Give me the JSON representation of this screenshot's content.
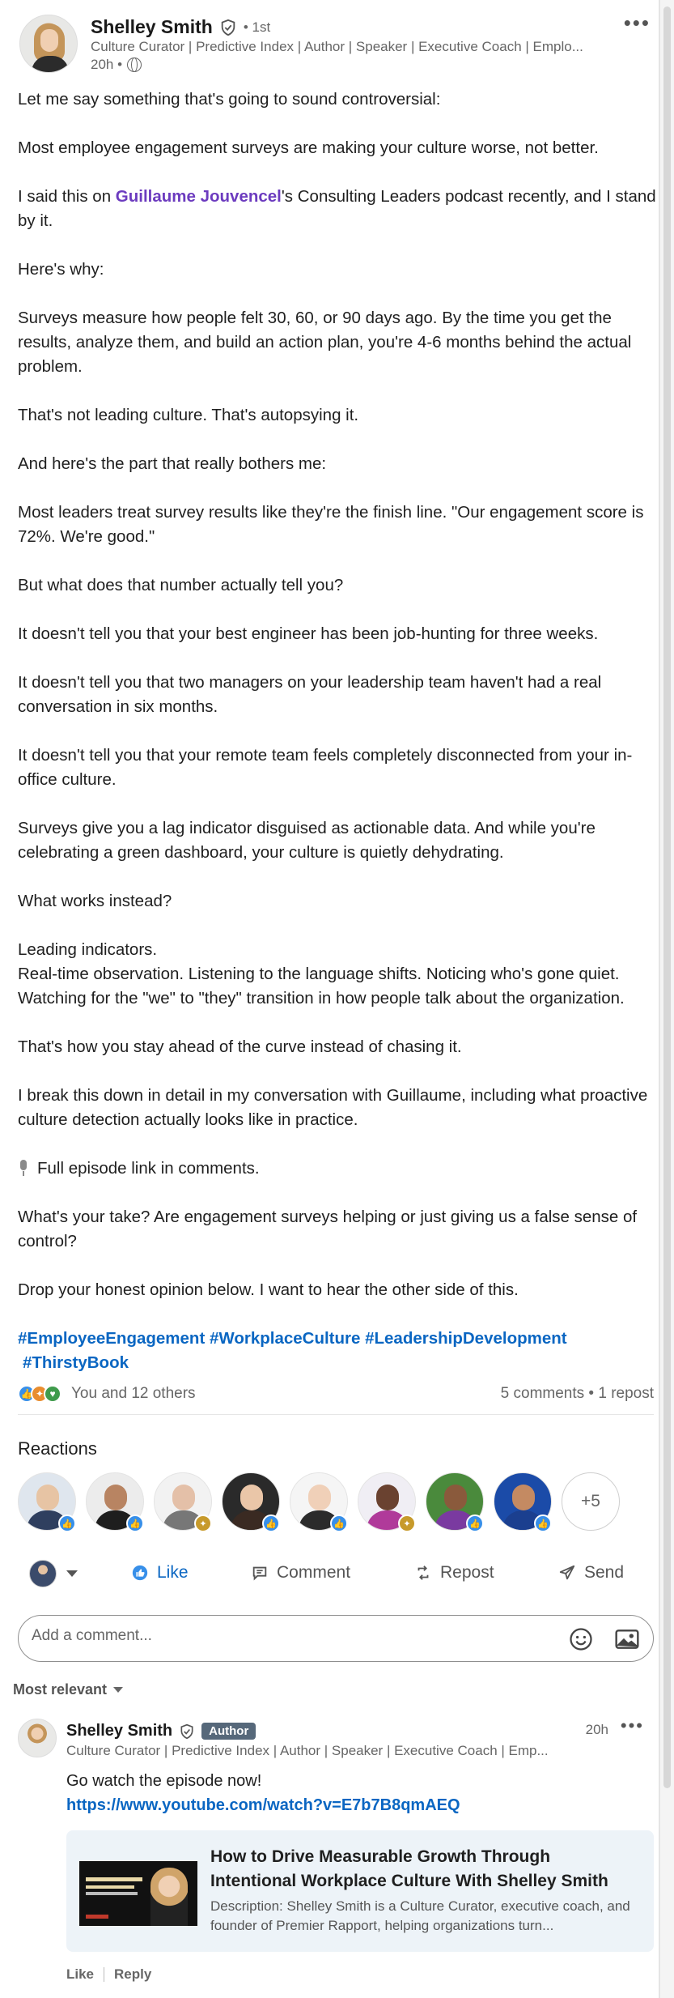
{
  "post": {
    "author": {
      "name": "Shelley Smith",
      "degree": "• 1st",
      "headline": "Culture Curator | Predictive Index | Author | Speaker | Executive Coach | Emplo...",
      "time": "20h •"
    },
    "body": {
      "p1": "Let me say something that's going to sound controversial:",
      "p2": "Most employee engagement surveys are making your culture worse, not better.",
      "p3_before": "I said this on ",
      "p3_mention": "Guillaume Jouvencel",
      "p3_after": "'s Consulting Leaders podcast recently, and I stand by it.",
      "p4": "Here's why:",
      "p5": "Surveys measure how people felt 30, 60, or 90 days ago. By the time you get the results, analyze them, and build an action plan, you're 4-6 months behind the actual problem.",
      "p6": "That's not leading culture. That's autopsying it.",
      "p7": "And here's the part that really bothers me:",
      "p8": "Most leaders treat survey results like they're the finish line. \"Our engagement score is 72%. We're good.\"",
      "p9": "But what does that number actually tell you?",
      "p10": "It doesn't tell you that your best engineer has been job-hunting for three weeks.",
      "p11": "It doesn't tell you that two managers on your leadership team haven't had a real conversation in six months.",
      "p12": "It doesn't tell you that your remote team feels completely disconnected from your in-office culture.",
      "p13": "Surveys give you a lag indicator disguised as actionable data. And while you're celebrating a green dashboard, your culture is quietly dehydrating.",
      "p14": "What works instead?",
      "p15_l1": "Leading indicators.",
      "p15_l2": "Real-time observation. Listening to the language shifts. Noticing who's gone quiet. Watching for the \"we\" to \"they\" transition in how people talk about the organization.",
      "p16": "That's how you stay ahead of the curve instead of chasing it.",
      "p17": "I break this down in detail in my conversation with Guillaume, including what proactive culture detection actually looks like in practice.",
      "p18": "Full episode link in comments.",
      "p19": "What's your take? Are engagement surveys helping or just giving us a false sense of control?",
      "p20": "Drop your honest opinion below. I want to hear the other side of this.",
      "hashtags_l1": "#EmployeeEngagement #WorkplaceCulture #LeadershipDevelopment",
      "hashtags_l2": "#ThirstyBook"
    },
    "social": {
      "reactions_text": "You and 12 others",
      "comments_reposts": "5 comments • 1 repost"
    }
  },
  "reactions_section": {
    "title": "Reactions",
    "more_label": "+5",
    "reactors": [
      {
        "badge": "like",
        "face": "#e7c4a4",
        "body": "#2f3f5f",
        "bg": "#dfe6ee"
      },
      {
        "badge": "like",
        "face": "#b88462",
        "body": "#1e1e1e",
        "bg": "#ececec"
      },
      {
        "badge": "insightful",
        "face": "#e4c0a8",
        "body": "#777777",
        "bg": "#f2f2f2"
      },
      {
        "badge": "like",
        "face": "#eac6a8",
        "body": "#3a2a22",
        "bg": "#2a2a2a"
      },
      {
        "badge": "like",
        "face": "#f0d0b8",
        "body": "#2b2b2b",
        "bg": "#f5f5f5"
      },
      {
        "badge": "insightful",
        "face": "#6a4230",
        "body": "#b03a9a",
        "bg": "#f0eef4"
      },
      {
        "badge": "like",
        "face": "#8a5a3c",
        "body": "#7a3aa0",
        "bg": "#4a8a3c"
      },
      {
        "badge": "like",
        "face": "#c48a62",
        "body": "#1b3f8f",
        "bg": "#1b4ba8"
      }
    ]
  },
  "actions": {
    "like": "Like",
    "comment": "Comment",
    "repost": "Repost",
    "send": "Send"
  },
  "comment_box": {
    "placeholder": "Add a comment..."
  },
  "sort": {
    "label": "Most relevant"
  },
  "comment": {
    "name": "Shelley Smith",
    "author_badge": "Author",
    "time": "20h",
    "headline": "Culture Curator | Predictive Index | Author | Speaker | Executive Coach | Emp...",
    "text": "Go watch the episode now!",
    "link": "https://www.youtube.com/watch?v=E7b7B8qmAEQ",
    "preview": {
      "title": "How to Drive Measurable Growth Through Intentional Workplace Culture With Shelley Smith",
      "description": "Description: Shelley Smith is a Culture Curator, executive coach, and founder of Premier Rapport, helping organizations turn..."
    },
    "like_label": "Like",
    "reply_label": "Reply"
  },
  "colors": {
    "link_blue": "#0a66c2",
    "mention_purple": "#6c3bbf",
    "author_badge": "#56687a"
  }
}
